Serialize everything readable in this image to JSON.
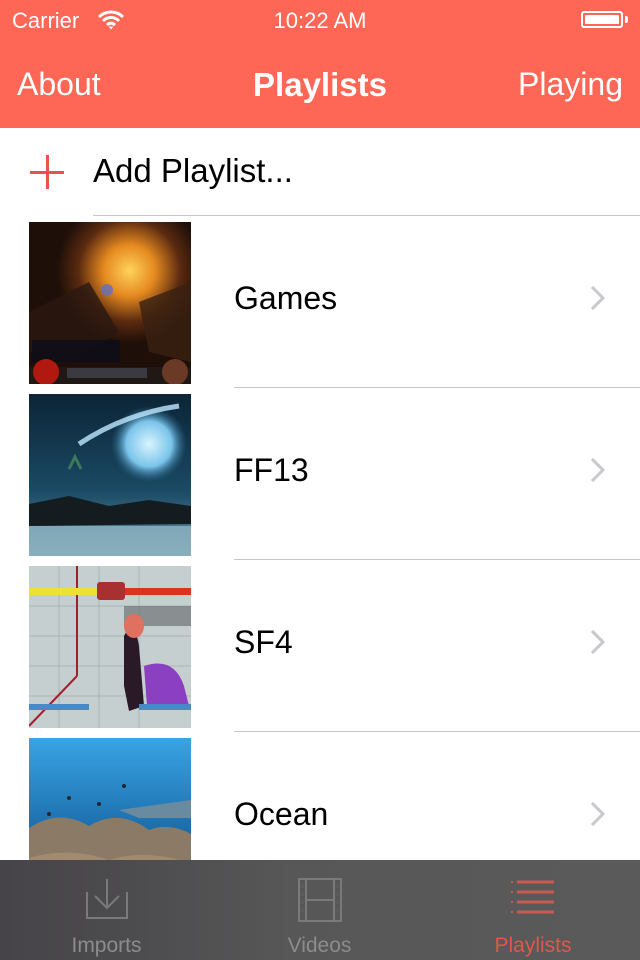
{
  "status_bar": {
    "carrier": "Carrier",
    "time": "10:22 AM",
    "wifi_icon": "wifi-icon",
    "battery_icon": "battery-icon"
  },
  "nav": {
    "left_button": "About",
    "title": "Playlists",
    "right_button": "Playing"
  },
  "list": {
    "add_label": "Add Playlist...",
    "add_icon": "plus-icon",
    "items": [
      {
        "label": "Games",
        "thumbnail": "game-screenshot-dungeon"
      },
      {
        "label": "FF13",
        "thumbnail": "game-screenshot-night-sea"
      },
      {
        "label": "SF4",
        "thumbnail": "game-screenshot-fighting"
      },
      {
        "label": "Ocean",
        "thumbnail": "underwater-reef"
      }
    ]
  },
  "tab_bar": {
    "tabs": [
      {
        "label": "Imports",
        "icon": "download-tray-icon",
        "active": false
      },
      {
        "label": "Videos",
        "icon": "film-strip-icon",
        "active": false
      },
      {
        "label": "Playlists",
        "icon": "list-icon",
        "active": true
      }
    ]
  },
  "colors": {
    "accent": "#fe6656",
    "tab_active": "#e0574c",
    "tab_inactive": "#8c8c8c",
    "tab_bar_bg": "#5a5a5a",
    "separator": "#c8c7cc"
  }
}
